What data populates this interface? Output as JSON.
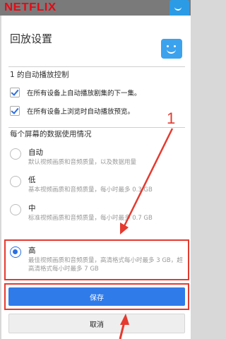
{
  "app": {
    "brand": "NETFLIX"
  },
  "dialog": {
    "title": "回放设置",
    "autoplay": {
      "heading": "1 的自动播放控制",
      "options": [
        {
          "label": "在所有设备上自动播放剧集的下一集。",
          "checked": true
        },
        {
          "label": "在所有设备上浏览时自动播放预览。",
          "checked": true
        }
      ]
    },
    "data_usage": {
      "heading": "每个屏幕的数据使用情况",
      "options": [
        {
          "title": "自动",
          "desc": "默认视频画质和音频质量，以及数据用量",
          "selected": false
        },
        {
          "title": "低",
          "desc": "基本视频画质和音频质量，每小时最多 0.3 GB",
          "selected": false
        },
        {
          "title": "中",
          "desc": "标准视频画质和音频质量，每小时最多 0.7 GB",
          "selected": false
        },
        {
          "title": "高",
          "desc": "最佳视频画质和音频质量，高清格式每小时最多 3 GB，超高清格式每小时最多 7 GB",
          "selected": true
        }
      ]
    },
    "buttons": {
      "save": "保存",
      "cancel": "取消"
    }
  },
  "annotation": {
    "number": "1",
    "color": "#e53a2f"
  },
  "colors": {
    "accent": "#2f7bea",
    "brand": "#e50914",
    "avatar": "#3ba2ee"
  }
}
